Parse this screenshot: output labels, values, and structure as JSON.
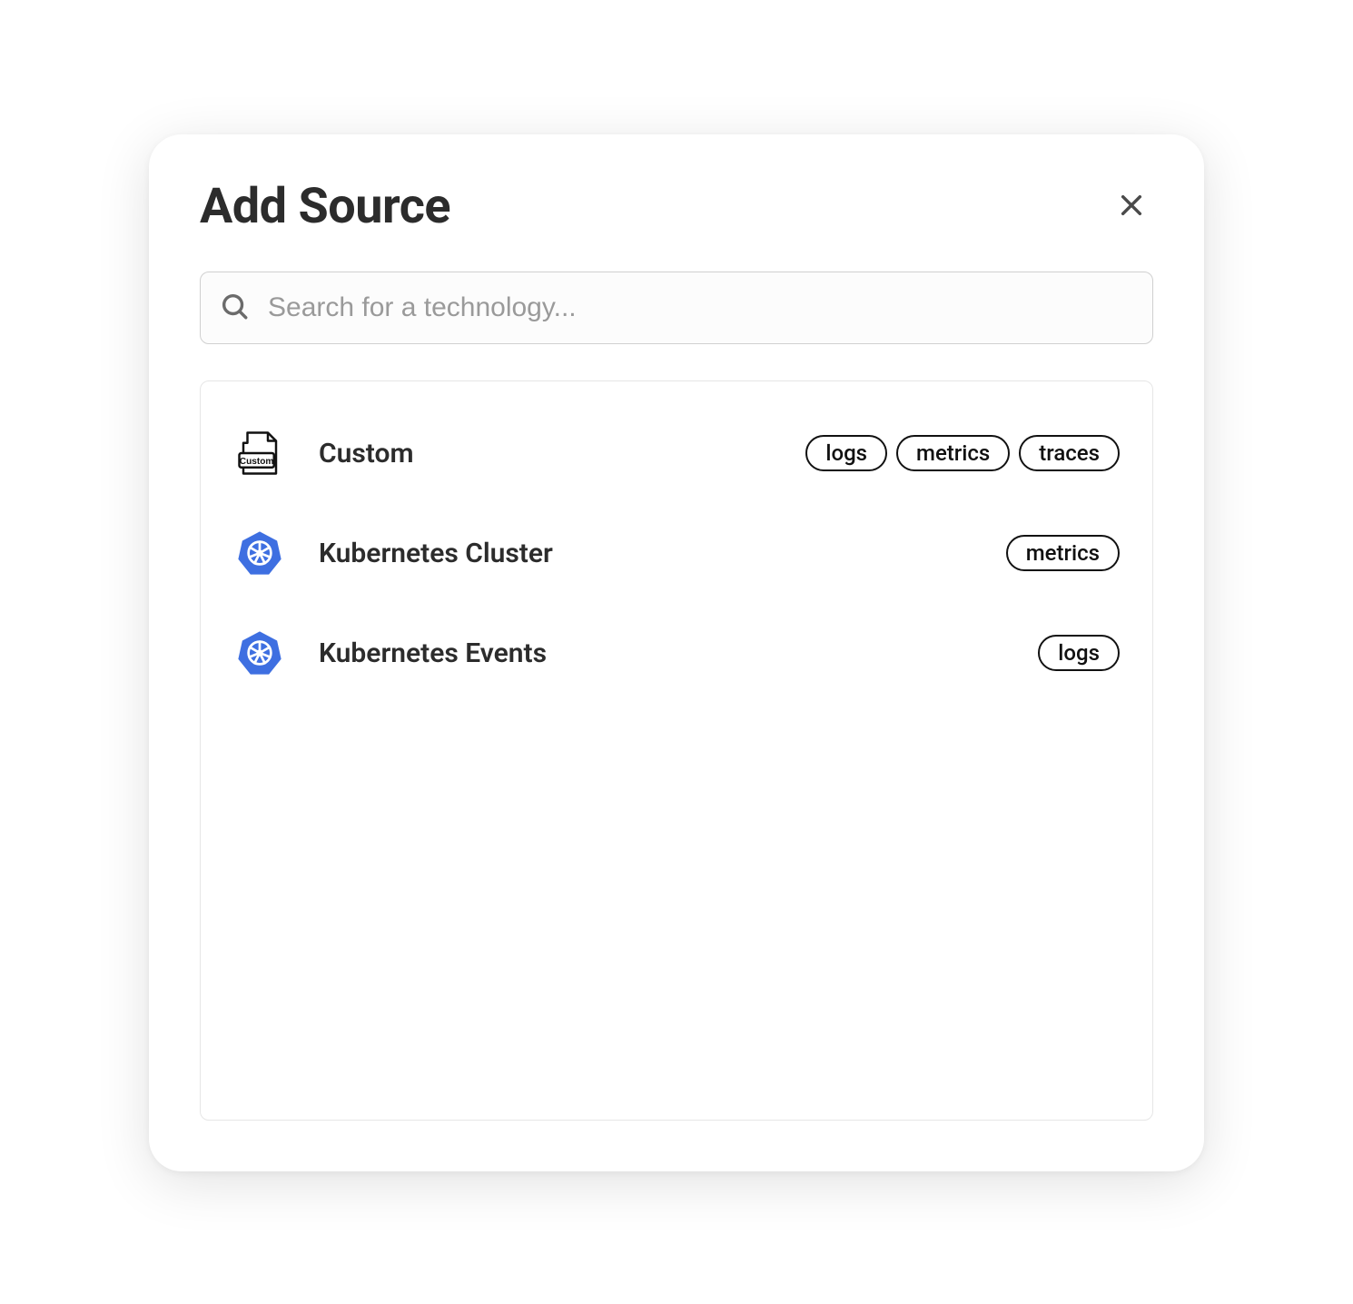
{
  "modal": {
    "title": "Add Source",
    "search": {
      "placeholder": "Search for a technology...",
      "value": ""
    },
    "sources": [
      {
        "icon": "custom-file-icon",
        "label": "Custom",
        "tags": [
          "logs",
          "metrics",
          "traces"
        ]
      },
      {
        "icon": "kubernetes-icon",
        "label": "Kubernetes Cluster",
        "tags": [
          "metrics"
        ]
      },
      {
        "icon": "kubernetes-icon",
        "label": "Kubernetes Events",
        "tags": [
          "logs"
        ]
      }
    ]
  }
}
